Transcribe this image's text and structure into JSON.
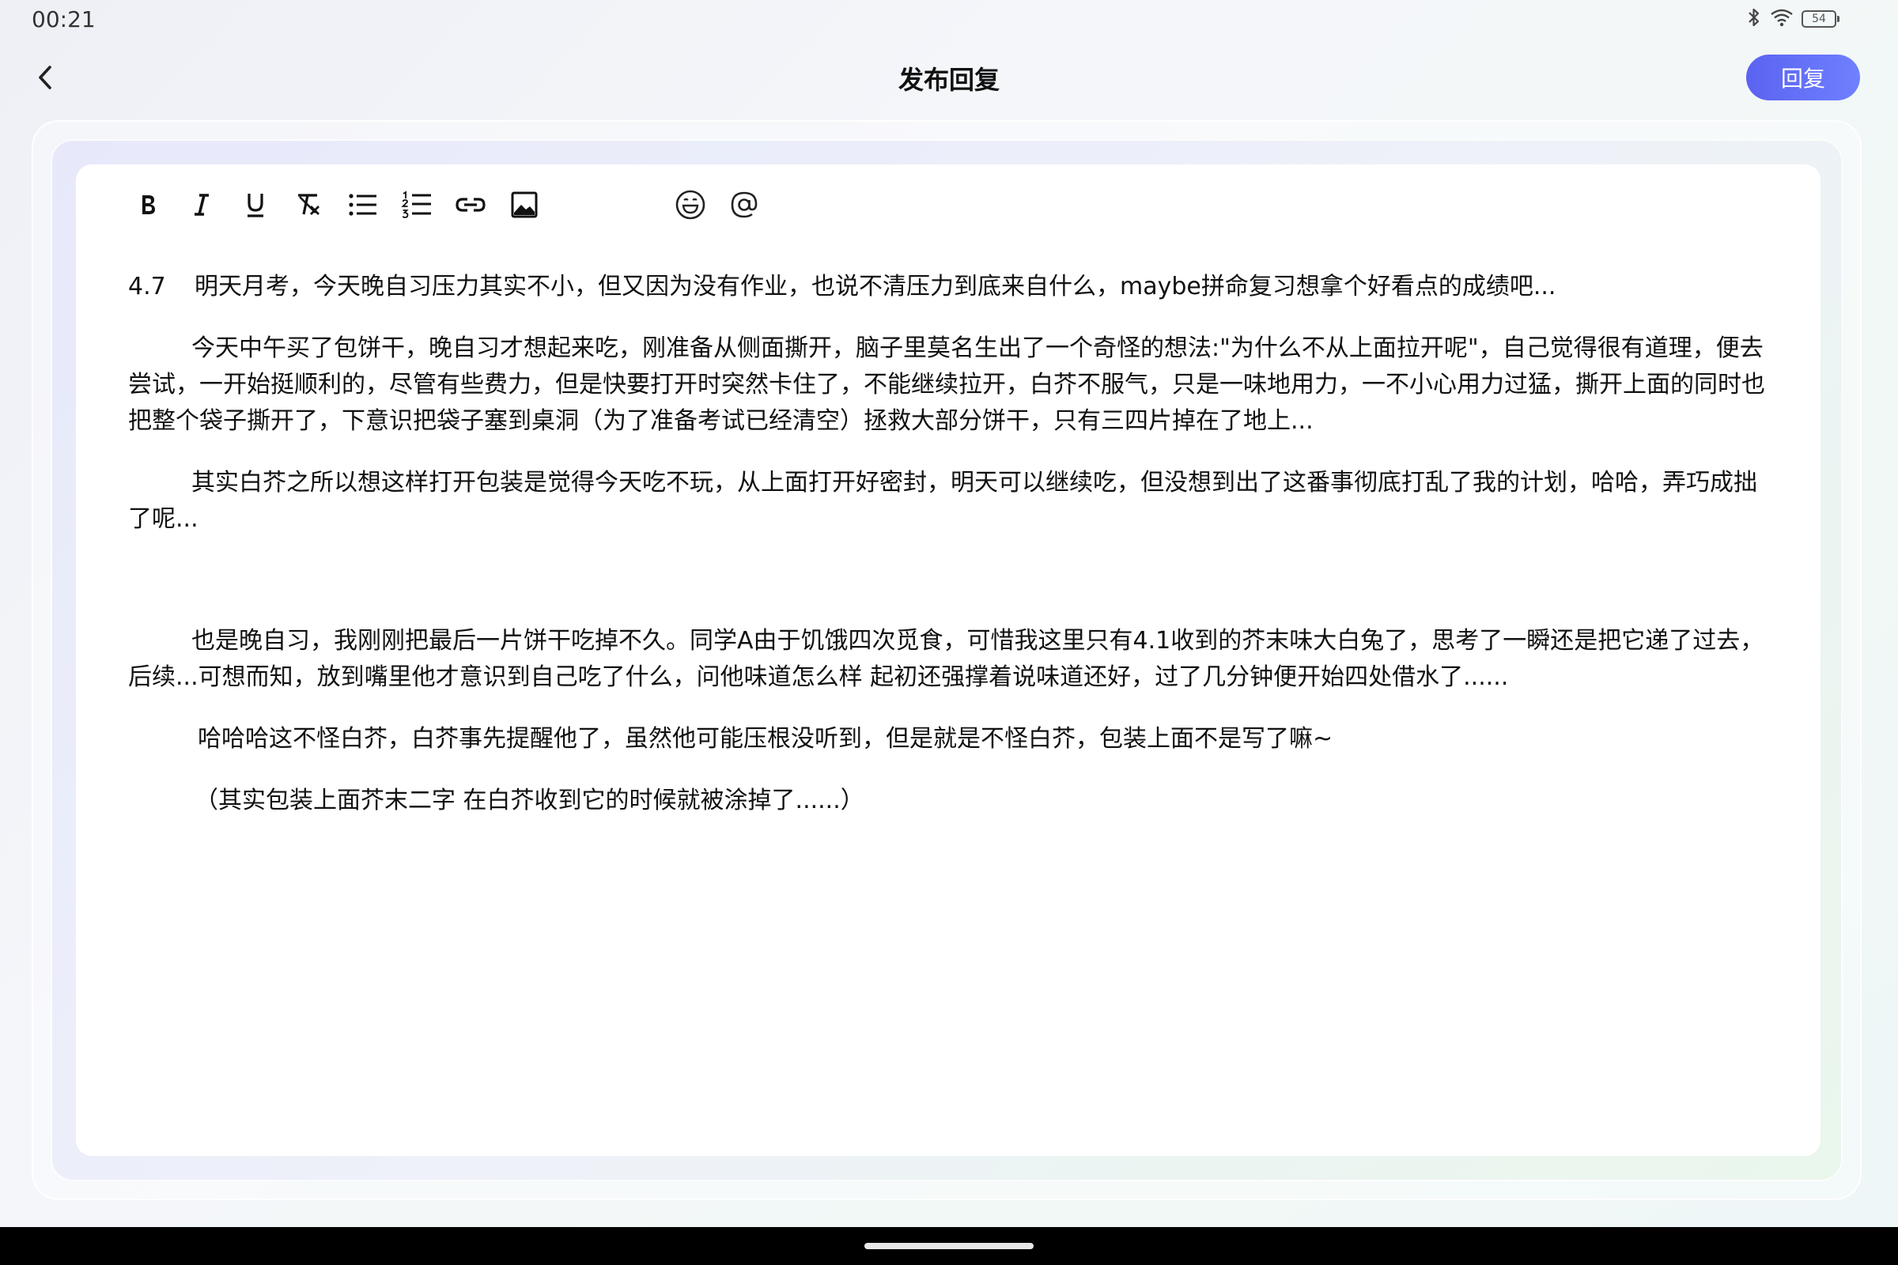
{
  "status_bar": {
    "time": "00:21",
    "battery": "54"
  },
  "header": {
    "title": "发布回复",
    "reply_label": "回复"
  },
  "toolbar": {
    "items": [
      "bold",
      "italic",
      "underline",
      "clear-format",
      "bullet-list",
      "numbered-list",
      "link",
      "image",
      "emoji",
      "mention"
    ]
  },
  "post": {
    "date": "4.7",
    "first_line": "明天月考，今天晚自习压力其实不小，但又因为没有作业，也说不清压力到底来自什么，maybe拼命复习想拿个好看点的成绩吧...",
    "paragraphs": [
      "今天中午买了包饼干，晚自习才想起来吃，刚准备从侧面撕开，脑子里莫名生出了一个奇怪的想法:\"为什么不从上面拉开呢\"，自己觉得很有道理，便去尝试，一开始挺顺利的，尽管有些费力，但是快要打开时突然卡住了，不能继续拉开，白芥不服气，只是一味地用力，一不小心用力过猛，撕开上面的同时也把整个袋子撕开了，下意识把袋子塞到桌洞（为了准备考试已经清空）拯救大部分饼干，只有三四片掉在了地上...",
      "其实白芥之所以想这样打开包装是觉得今天吃不玩，从上面打开好密封，明天可以继续吃，但没想到出了这番事彻底打乱了我的计划，哈哈，弄巧成拙了呢...",
      "也是晚自习，我刚刚把最后一片饼干吃掉不久。同学A由于饥饿四次觅食，可惜我这里只有4.1收到的芥末味大白兔了，思考了一瞬还是把它递了过去，后续...可想而知，放到嘴里他才意识到自己吃了什么，问他味道怎么样 起初还强撑着说味道还好，过了几分钟便开始四处借水了......",
      "哈哈哈这不怪白芥，白芥事先提醒他了，虽然他可能压根没听到，但是就是不怪白芥，包装上面不是写了嘛~",
      "（其实包装上面芥末二字 在白芥收到它的时候就被涂掉了......）"
    ]
  }
}
